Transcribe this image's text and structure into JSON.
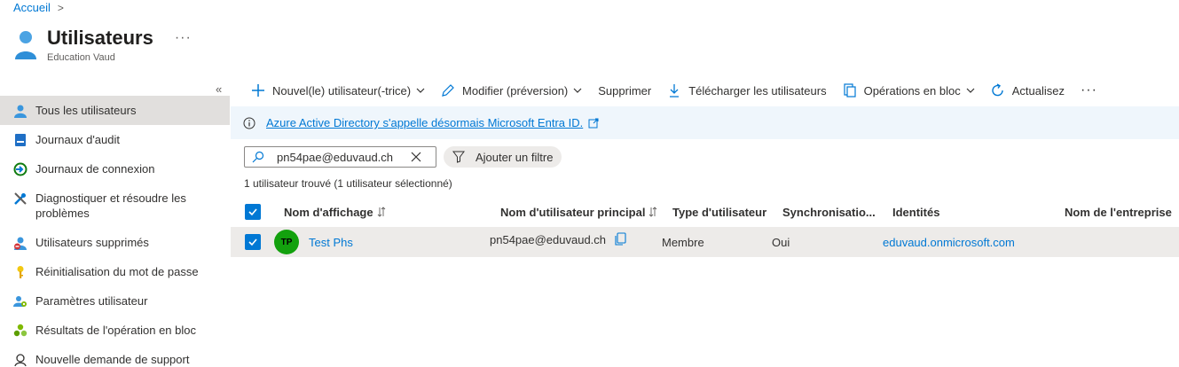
{
  "breadcrumb": {
    "home": "Accueil",
    "separator": ">"
  },
  "header": {
    "title": "Utilisateurs",
    "more": "···",
    "subtitle": "Education Vaud"
  },
  "sidebar": {
    "collapse": "«",
    "items": [
      {
        "label": "Tous les utilisateurs",
        "icon": "user-icon",
        "active": true
      },
      {
        "label": "Journaux d'audit",
        "icon": "audit-log-icon"
      },
      {
        "label": "Journaux de connexion",
        "icon": "sign-in-log-icon"
      },
      {
        "label": "Diagnostiquer et résoudre les problèmes",
        "icon": "wrench-icon"
      },
      {
        "label": "Utilisateurs supprimés",
        "icon": "deleted-user-icon"
      },
      {
        "label": "Réinitialisation du mot de passe",
        "icon": "key-icon"
      },
      {
        "label": "Paramètres utilisateur",
        "icon": "user-settings-icon"
      },
      {
        "label": "Résultats de l'opération en bloc",
        "icon": "bulk-results-icon"
      },
      {
        "label": "Nouvelle demande de support",
        "icon": "support-icon"
      }
    ]
  },
  "toolbar": {
    "new_user": "Nouvel(le) utilisateur(-trice)",
    "edit": "Modifier (préversion)",
    "delete": "Supprimer",
    "download": "Télécharger les utilisateurs",
    "bulk": "Opérations en bloc",
    "refresh": "Actualisez",
    "more": "···"
  },
  "banner": {
    "text": "Azure Active Directory s'appelle désormais Microsoft Entra ID."
  },
  "search": {
    "value": "pn54pae@eduvaud.ch"
  },
  "filter": {
    "label": "Ajouter un filtre"
  },
  "result_count": "1 utilisateur trouvé (1 utilisateur sélectionné)",
  "table": {
    "columns": {
      "display_name": "Nom d'affichage",
      "upn": "Nom d'utilisateur principal",
      "user_type": "Type d'utilisateur",
      "sync": "Synchronisatio...",
      "identities": "Identités",
      "company": "Nom de l'entreprise"
    },
    "rows": [
      {
        "initials": "TP",
        "display_name": "Test Phs",
        "upn": "pn54pae@eduvaud.ch",
        "user_type": "Membre",
        "sync": "Oui",
        "identities": "eduvaud.onmicrosoft.com",
        "company": ""
      }
    ]
  },
  "colors": {
    "accent": "#0078d4",
    "avatar": "#13a10e",
    "selected_row": "#edebe9",
    "banner": "#eff6fc"
  }
}
